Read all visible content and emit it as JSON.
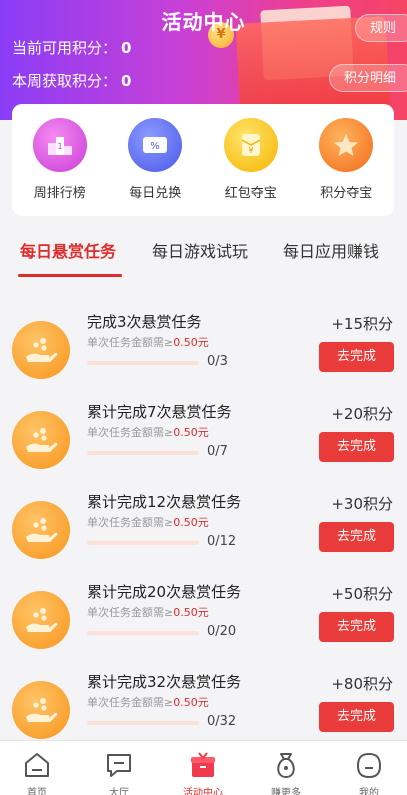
{
  "header": {
    "title": "活动中心",
    "available_points_label": "当前可用积分：",
    "available_points": "0",
    "weekly_points_label": "本周获取积分：",
    "weekly_points": "0",
    "rules_label": "规则",
    "points_detail_label": "积分明细",
    "gradient": [
      "#8a3df6",
      "#c940d6",
      "#ee3f8c",
      "#f54464"
    ]
  },
  "quick_links": [
    {
      "label": "周排行榜",
      "icon": "podium-icon",
      "color": "#c93bd6"
    },
    {
      "label": "每日兑换",
      "icon": "coupon-icon",
      "color": "#4a58e8"
    },
    {
      "label": "红包夺宝",
      "icon": "red-envelope-icon",
      "color": "#f5b400"
    },
    {
      "label": "积分夺宝",
      "icon": "star-coin-icon",
      "color": "#f36b1c"
    }
  ],
  "tabs": [
    {
      "label": "每日悬赏任务",
      "active": true
    },
    {
      "label": "每日游戏试玩",
      "active": false
    },
    {
      "label": "每日应用赚钱",
      "active": false
    }
  ],
  "tasks": [
    {
      "title": "完成3次悬赏任务",
      "sub_prefix": "单次任务金额需≥",
      "amount": "0.50元",
      "progress_text": "0/3",
      "progress": 0,
      "reward": "+15积分",
      "button": "去完成"
    },
    {
      "title": "累计完成7次悬赏任务",
      "sub_prefix": "单次任务金额需≥",
      "amount": "0.50元",
      "progress_text": "0/7",
      "progress": 0,
      "reward": "+20积分",
      "button": "去完成"
    },
    {
      "title": "累计完成12次悬赏任务",
      "sub_prefix": "单次任务金额需≥",
      "amount": "0.50元",
      "progress_text": "0/12",
      "progress": 0,
      "reward": "+30积分",
      "button": "去完成"
    },
    {
      "title": "累计完成20次悬赏任务",
      "sub_prefix": "单次任务金额需≥",
      "amount": "0.50元",
      "progress_text": "0/20",
      "progress": 0,
      "reward": "+50积分",
      "button": "去完成"
    },
    {
      "title": "累计完成32次悬赏任务",
      "sub_prefix": "单次任务金额需≥",
      "amount": "0.50元",
      "progress_text": "0/32",
      "progress": 0,
      "reward": "+80积分",
      "button": "去完成"
    }
  ],
  "bottom_nav": [
    {
      "label": "首页",
      "icon": "home-icon",
      "active": false
    },
    {
      "label": "大厅",
      "icon": "chat-hall-icon",
      "active": false
    },
    {
      "label": "活动中心",
      "icon": "gift-box-icon",
      "active": true
    },
    {
      "label": "赚更多",
      "icon": "money-bag-icon",
      "active": false
    },
    {
      "label": "我的",
      "icon": "profile-icon",
      "active": false
    }
  ],
  "colors": {
    "accent": "#e02b2b",
    "button": "#ea3b3b"
  }
}
